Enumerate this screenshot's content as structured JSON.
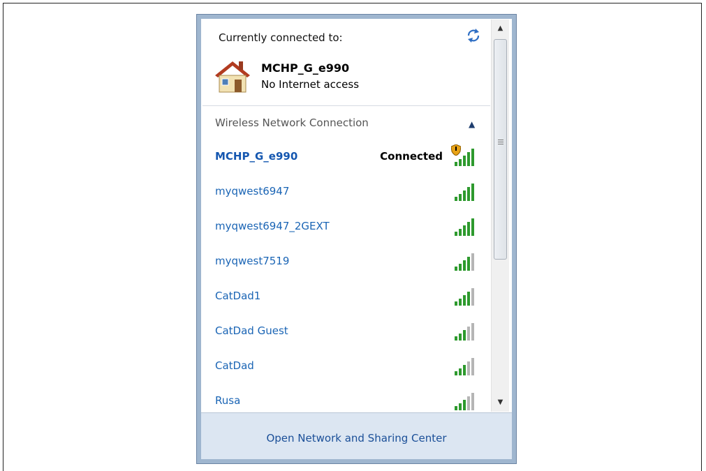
{
  "connected_header": {
    "label": "Currently connected to:",
    "network_name": "MCHP_G_e990",
    "status": "No Internet access"
  },
  "section": {
    "label": "Wireless Network Connection"
  },
  "networks": [
    {
      "name": "MCHP_G_e990",
      "status": "Connected",
      "secured": true,
      "bars": 5
    },
    {
      "name": "myqwest6947",
      "status": "",
      "bars": 5
    },
    {
      "name": "myqwest6947_2GEXT",
      "status": "",
      "bars": 5
    },
    {
      "name": "myqwest7519",
      "status": "",
      "bars": 4
    },
    {
      "name": "CatDad1",
      "status": "",
      "bars": 4
    },
    {
      "name": "CatDad Guest",
      "status": "",
      "bars": 3
    },
    {
      "name": "CatDad",
      "status": "",
      "bars": 3
    },
    {
      "name": "Rusa",
      "status": "",
      "bars": 3
    }
  ],
  "footer": {
    "link_label": "Open Network and Sharing Center"
  },
  "colors": {
    "link": "#1b65b5",
    "signal_on": "#2e9a2e",
    "signal_off": "#b5b5b5"
  }
}
